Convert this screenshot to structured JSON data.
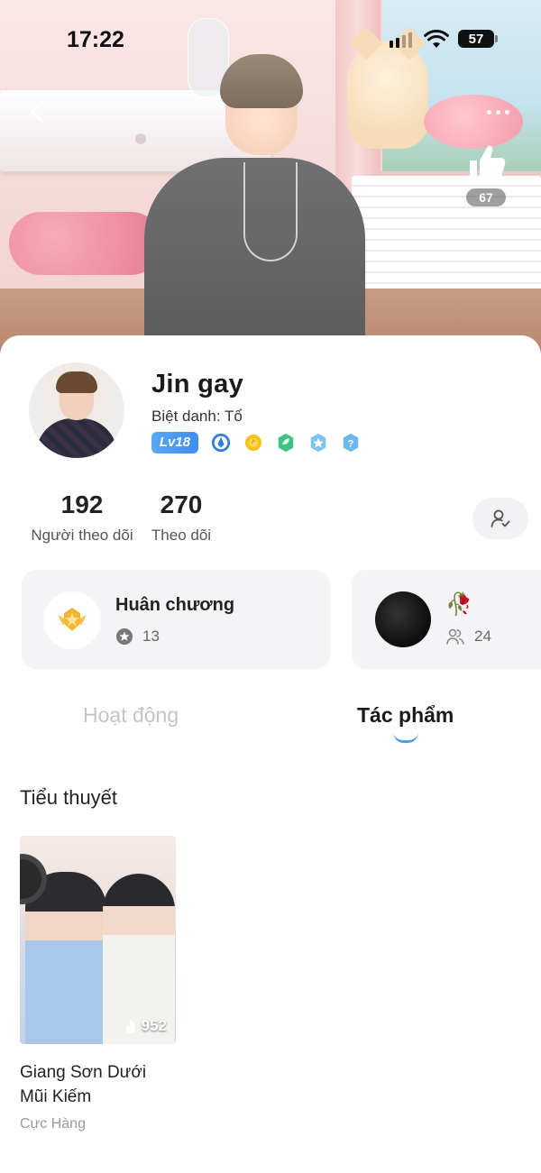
{
  "status_bar": {
    "time": "17:22",
    "battery": "57"
  },
  "header": {
    "like_count": "67"
  },
  "profile": {
    "username": "Jin gay",
    "nickname": "Biệt danh: Tổ",
    "level_badge": "Lv18",
    "badge_icons": [
      "pen-badge-icon",
      "coin-badge-icon",
      "leaf-badge-icon",
      "star-badge-icon",
      "question-badge-icon"
    ],
    "accent_color": "#4a9cf0"
  },
  "stats": {
    "followers_count": "192",
    "followers_label": "Người theo dõi",
    "following_count": "270",
    "following_label": "Theo dõi"
  },
  "medal_tile": {
    "title": "Huân chương",
    "count": "13"
  },
  "group_tile": {
    "emoji": "🥀",
    "member_count": "24"
  },
  "tabs": [
    {
      "label": "Hoạt động",
      "active": false
    },
    {
      "label": "Tác phẩm",
      "active": true
    }
  ],
  "section": {
    "title": "Tiểu thuyết"
  },
  "novels": [
    {
      "title": "Giang Sơn Dưới Mũi Kiếm",
      "author": "Cực Hàng",
      "views": "952"
    }
  ]
}
